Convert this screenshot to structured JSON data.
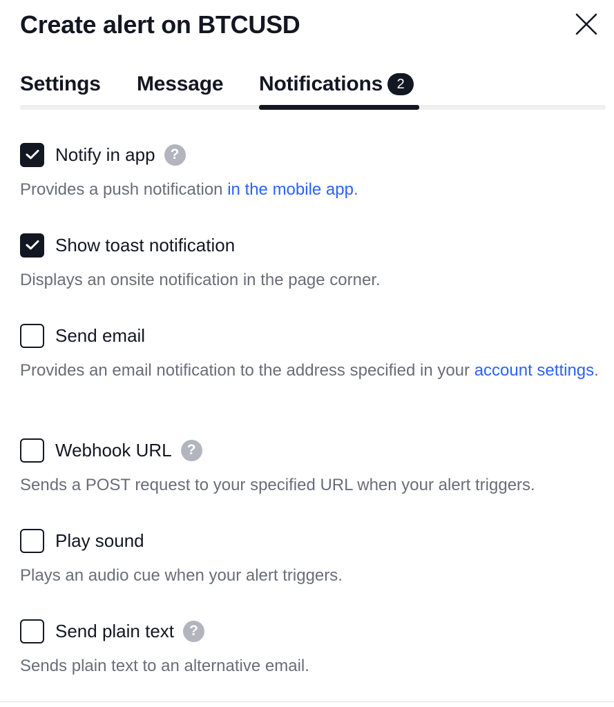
{
  "dialog": {
    "title": "Create alert on BTCUSD",
    "close_icon": "close-icon"
  },
  "tabs": [
    {
      "label": "Settings"
    },
    {
      "label": "Message"
    },
    {
      "label": "Notifications",
      "badge": "2",
      "active": true
    }
  ],
  "options": [
    {
      "label": "Notify in app",
      "checked": true,
      "help_icon": "question-mark-icon",
      "help_glyph": "?",
      "desc_before": "Provides a push notification ",
      "desc_link": "in the mobile app",
      "desc_after": "."
    },
    {
      "label": "Show toast notification",
      "checked": true,
      "desc": "Displays an onsite notification in the page corner."
    },
    {
      "label": "Send email",
      "checked": false,
      "desc_before": "Provides an email notification to the address specified in your ",
      "desc_link": "account settings",
      "desc_after": "."
    },
    {
      "label": "Webhook URL",
      "checked": false,
      "help_icon": "question-mark-icon",
      "help_glyph": "?",
      "desc": "Sends a POST request to your specified URL when your alert triggers."
    },
    {
      "label": "Play sound",
      "checked": false,
      "desc": "Plays an audio cue when your alert triggers."
    },
    {
      "label": "Send plain text",
      "checked": false,
      "help_icon": "question-mark-icon",
      "help_glyph": "?",
      "desc": "Sends plain text to an alternative email."
    }
  ],
  "colors": {
    "text": "#131722",
    "muted": "#6a6d78",
    "link": "#2962ff",
    "help_icon_bg": "#b2b5be",
    "tab_track": "#efefef"
  }
}
